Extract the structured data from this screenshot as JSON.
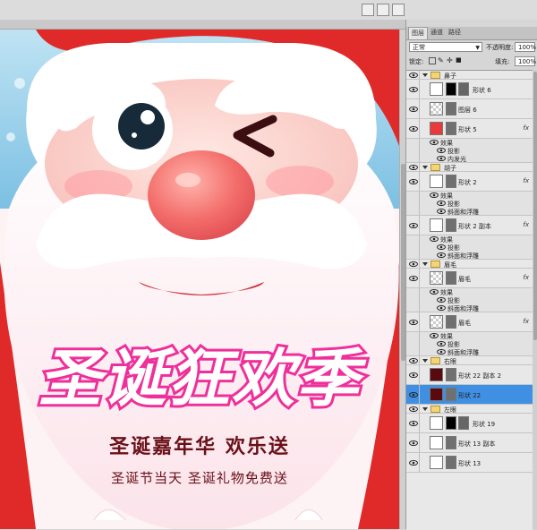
{
  "colors": {
    "santa_red": "#e02a2a",
    "title_pink": "#ef2f9a",
    "subtitle_dark": "#6a1018",
    "canvas_bg": "#fdf2f4",
    "selection_blue": "#3f8fe3"
  },
  "panel": {
    "tabs": [
      "图层",
      "通道",
      "路径"
    ],
    "blend_mode": "正常",
    "opacity_label": "不透明度:",
    "opacity_value": "100%",
    "lock_label": "锁定:",
    "fill_label": "填充:",
    "fill_value": "100%"
  },
  "layers": [
    {
      "type": "group",
      "name": "鼻子"
    },
    {
      "type": "layer",
      "name": "形状 6",
      "thumb": "white",
      "mask": "black"
    },
    {
      "type": "layer",
      "name": "图层 6",
      "thumb": "checker"
    },
    {
      "type": "layer",
      "name": "形状 5",
      "thumb": "red",
      "fx": "fx"
    },
    {
      "type": "effects",
      "label": "效果",
      "items": [
        "投影",
        "内发光"
      ]
    },
    {
      "type": "group",
      "name": "胡子"
    },
    {
      "type": "layer",
      "name": "形状 2",
      "thumb": "white",
      "fx": "fx"
    },
    {
      "type": "effects",
      "label": "效果",
      "items": [
        "投影",
        "斜面和浮雕"
      ]
    },
    {
      "type": "layer",
      "name": "形状 2 副本",
      "thumb": "white",
      "fx": "fx"
    },
    {
      "type": "effects",
      "label": "效果",
      "items": [
        "投影",
        "斜面和浮雕"
      ]
    },
    {
      "type": "group",
      "name": "眉毛"
    },
    {
      "type": "layer",
      "name": "眉毛",
      "thumb": "checker",
      "fx": "fx"
    },
    {
      "type": "effects",
      "label": "效果",
      "items": [
        "投影",
        "斜面和浮雕"
      ]
    },
    {
      "type": "layer",
      "name": "眉毛",
      "thumb": "checker",
      "fx": "fx"
    },
    {
      "type": "effects",
      "label": "效果",
      "items": [
        "投影",
        "斜面和浮雕"
      ]
    },
    {
      "type": "group",
      "name": "右眼"
    },
    {
      "type": "layer",
      "name": "形状 22 副本 2",
      "thumb": "darkred"
    },
    {
      "type": "layer",
      "name": "形状 22",
      "thumb": "darkred",
      "selected": true
    },
    {
      "type": "group",
      "name": "左眼"
    },
    {
      "type": "layer",
      "name": "形状 19",
      "thumb": "white",
      "mask": "black"
    },
    {
      "type": "layer",
      "name": "形状 13 副本",
      "thumb": "white"
    },
    {
      "type": "layer",
      "name": "形状 13",
      "thumb": "white"
    }
  ],
  "poster": {
    "title": "圣诞狂欢季",
    "subtitle": "圣诞嘉年华 欢乐送",
    "tagline": "圣诞节当天 圣诞礼物免费送"
  }
}
